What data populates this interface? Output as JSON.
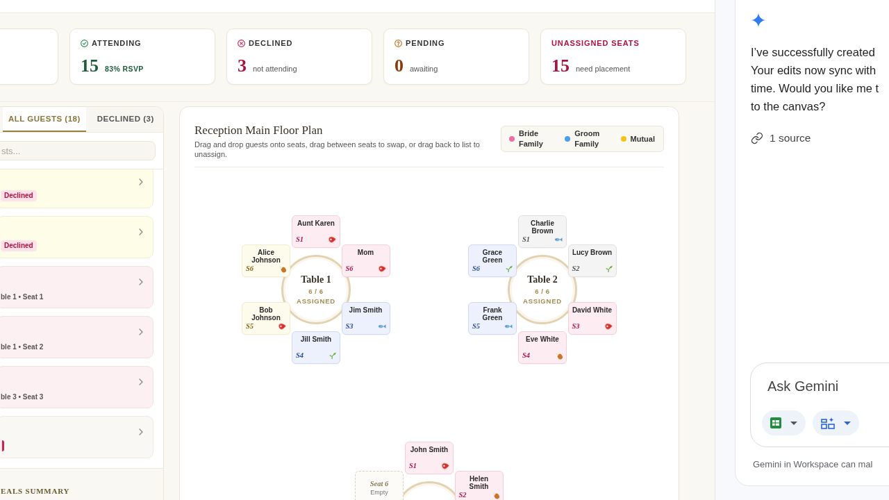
{
  "stats": [
    {
      "kind": "attending",
      "label": "ATTENDING",
      "value": "15",
      "note": "83% RSVP"
    },
    {
      "kind": "declined",
      "label": "DECLINED",
      "value": "3",
      "note": "not attending"
    },
    {
      "kind": "pending",
      "label": "PENDING",
      "value": "0",
      "note": "awaiting"
    },
    {
      "kind": "unassigned",
      "label": "UNASSIGNED SEATS",
      "value": "15",
      "note": "need placement"
    }
  ],
  "guest_panel": {
    "tabs": [
      {
        "label": "ALL GUESTS (18)",
        "selected": true
      },
      {
        "label": "DECLINED (3)",
        "selected": false
      }
    ],
    "search": {
      "placeholder": "sts..."
    },
    "guests": [
      {
        "color": "#fdfde8",
        "badge": "Declined"
      },
      {
        "color": "#fdfde8",
        "badge": "Declined"
      },
      {
        "color": "#fdf0f2",
        "seat": "ble 1 • Seat 1"
      },
      {
        "color": "#fdf0f2",
        "seat": "ble 1 • Seat 2"
      },
      {
        "color": "#fdf0f2",
        "seat": "ble 3 • Seat 3"
      },
      {
        "color": "#f9f8f4",
        "badge_fragment": true
      }
    ],
    "footer": "EALS SUMMARY"
  },
  "floor_plan": {
    "title": "Reception Main Floor Plan",
    "subtitle": "Drag and drop guests onto seats, drag between seats to swap, or drag back to list to unassign.",
    "legend": [
      {
        "label": "Bride Family",
        "color": "#f06ea5"
      },
      {
        "label": "Groom Family",
        "color": "#4b9ff0"
      },
      {
        "label": "Mutual",
        "color": "#f5c21b"
      }
    ],
    "tables": [
      {
        "name": "Table 1",
        "count": "6 / 6",
        "status": "ASSIGNED",
        "seats": [
          {
            "kind": "beef",
            "name": "Aunt Karen",
            "seat": "S1",
            "color": "#b01a4e"
          },
          {
            "kind": "chicken",
            "name": "Alice Johnson",
            "seat": "S6",
            "color": "#8c6414"
          },
          {
            "kind": "beef",
            "name": "Mom",
            "seat": "S6",
            "color": "#b01a4e"
          },
          {
            "kind": "beef",
            "name": "Bob Johnson",
            "seat": "S5",
            "color": "#8c6414"
          },
          {
            "kind": "fish",
            "name": "Jim Smith",
            "seat": "S3",
            "color": "#2c4fa6"
          },
          {
            "kind": "vegetarian",
            "name": "Jill Smith",
            "seat": "S4",
            "color": "#2c4fa6"
          }
        ]
      },
      {
        "name": "Table 2",
        "count": "6 / 6",
        "status": "ASSIGNED",
        "seats": [
          {
            "kind": "fish",
            "name": "Charlie Brown",
            "seat": "S1",
            "color": "#555555"
          },
          {
            "kind": "vegetarian",
            "name": "Grace Green",
            "seat": "S6",
            "color": "#2c4fa6"
          },
          {
            "kind": "vegetarian",
            "name": "Lucy Brown",
            "seat": "S2",
            "color": "#555555"
          },
          {
            "kind": "fish",
            "name": "Frank Green",
            "seat": "S5",
            "color": "#2c4fa6"
          },
          {
            "kind": "beef",
            "name": "David White",
            "seat": "S3",
            "color": "#b01a4e"
          },
          {
            "kind": "chicken",
            "name": "Eve White",
            "seat": "S4",
            "color": "#b01a4e"
          }
        ]
      },
      {
        "seats": [
          {
            "kind": "beef",
            "name": "John Smith",
            "seat": "S1",
            "color": "#b01a4e"
          },
          {
            "kind": "empty",
            "name": "Seat 6",
            "note": "Empty"
          },
          {
            "kind": "chicken",
            "name": "Helen Smith",
            "seat": "S2",
            "color": "#b01a4e"
          }
        ]
      }
    ]
  },
  "assistant": {
    "message_lines": [
      "I’ve successfully created",
      "Your edits now sync with",
      "time. Would you like me t",
      "to the canvas?"
    ],
    "source": "1 source",
    "input": {
      "placeholder": "Ask Gemini"
    },
    "footer": "Gemini in Workspace can mal"
  }
}
